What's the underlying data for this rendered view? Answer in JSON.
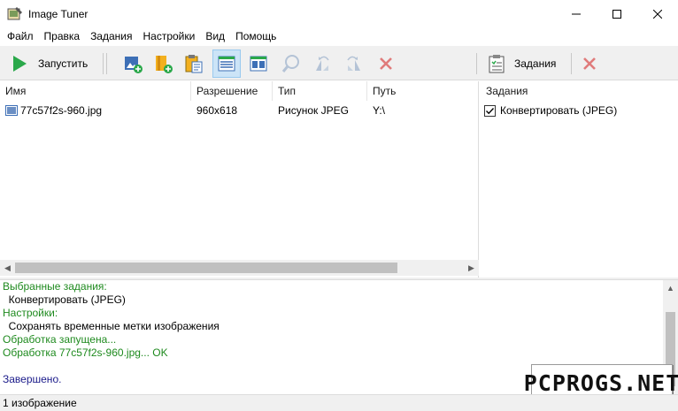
{
  "window": {
    "title": "Image Tuner"
  },
  "menu": [
    "Файл",
    "Правка",
    "Задания",
    "Настройки",
    "Вид",
    "Помощь"
  ],
  "toolbar": {
    "run_label": "Запустить",
    "tasks_label": "Задания",
    "icons": [
      "add-image-icon",
      "add-folder-icon",
      "paste-icon",
      "details-view-icon",
      "thumbnails-view-icon",
      "preview-icon",
      "rotate-left-icon",
      "rotate-right-icon",
      "remove-icon"
    ]
  },
  "files": {
    "columns": [
      "Имя",
      "Разрешение",
      "Тип",
      "Путь"
    ],
    "rows": [
      {
        "name": "77c57f2s-960.jpg",
        "resolution": "960x618",
        "type": "Рисунок JPEG",
        "path": "Y:\\"
      }
    ]
  },
  "tasks": {
    "header": "Задания",
    "items": [
      {
        "label": "Конвертировать (JPEG)",
        "checked": true
      }
    ]
  },
  "log": [
    {
      "text": "Выбранные задания:",
      "color": "#1e8a1e"
    },
    {
      "text": "  Конвертировать (JPEG)",
      "color": "#000000"
    },
    {
      "text": "Настройки:",
      "color": "#1e8a1e"
    },
    {
      "text": "  Сохранять временные метки изображения",
      "color": "#000000"
    },
    {
      "text": "Обработка запущена...",
      "color": "#1e8a1e"
    },
    {
      "text": "Обработка 77c57f2s-960.jpg... OK",
      "color": "#1e8a1e"
    },
    {
      "text": "",
      "color": "#000000"
    },
    {
      "text": "Завершено.",
      "color": "#1a1a8a"
    }
  ],
  "watermark": "PCPROGS.NET",
  "status": "1 изображение",
  "colors": {
    "run_green": "#2aa84a",
    "delete_red": "#d9534f",
    "log_green": "#1e8a1e",
    "log_blue": "#1a1a8a"
  }
}
